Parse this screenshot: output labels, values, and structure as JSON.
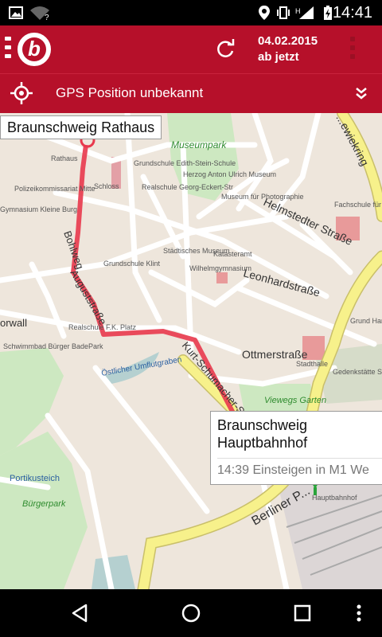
{
  "status_bar": {
    "time": "14:41",
    "icons": [
      "image-icon",
      "wifi-unknown-icon",
      "location-icon",
      "vibrate-icon",
      "signal-h-icon",
      "battery-charging-icon"
    ]
  },
  "app_bar": {
    "logo_letter": "b",
    "date": "04.02.2015",
    "time_mode": "ab jetzt"
  },
  "gps_bar": {
    "label": "GPS Position unbekannt"
  },
  "map": {
    "start_label": "Braunschweig Rathaus",
    "end_label_line1": "Braunschweig",
    "end_label_line2": "Hauptbahnhof",
    "end_sub": "14:39 Einsteigen in M1 We",
    "streets": {
      "bohlweg": "Bohlweg",
      "auguststrasse": "Auguststraße",
      "leonhardstrasse": "Leonhardstraße",
      "helmstedter": "Helmstedter Straße",
      "ottmerstrasse": "Ottmerstraße",
      "kurt_schumacher": "Kurt-Schumacher-Str",
      "wallring": "...ewiekring",
      "berliner": "Berliner P...",
      "wall_left": "orwall",
      "umflutgraben": "Östlicher Umflutgraben"
    },
    "pois": {
      "museumpark": "Museumpark",
      "rathaus": "Rathaus",
      "schloss": "Schloss",
      "polizei": "Polizeikommissariat Mitte",
      "gymnasium": "Gymnasium Kleine Burg",
      "grundschule_edith": "Grundschule Edith-Stein-Schule",
      "realschule_georg": "Realschule Georg-Eckert-Str",
      "herzog": "Herzog Anton Ulrich Museum",
      "museum_foto": "Museum für Photographie",
      "fachschule": "Fachschule für Technik",
      "grundschule_klint": "Grundschule Klint",
      "staedtisches": "Städtisches Museum",
      "katasteramt": "Katasteramt",
      "wilhelm": "Wilhelmgymnasium",
      "realschule_fk": "Realschule F.K. Platz",
      "schwimmbad": "Schwimmbad Bürger BadePark",
      "portikusteich": "Portikusteich",
      "buergerpark": "Bürgerpark",
      "viewegs": "Viewegs Garten",
      "stadthalle": "Stadthalle",
      "gedenkstaette": "Gedenkstätte Schillstraße",
      "grundschule_hans": "Grund Hans G Gymn",
      "hauptbahnhof": "Hauptbahnhof"
    }
  },
  "colors": {
    "brand_red": "#b6102a",
    "route_red": "#e8394d",
    "map_bg": "#eee6dc",
    "road_yellow": "#f7f18b",
    "park_green": "#cde8c1"
  }
}
